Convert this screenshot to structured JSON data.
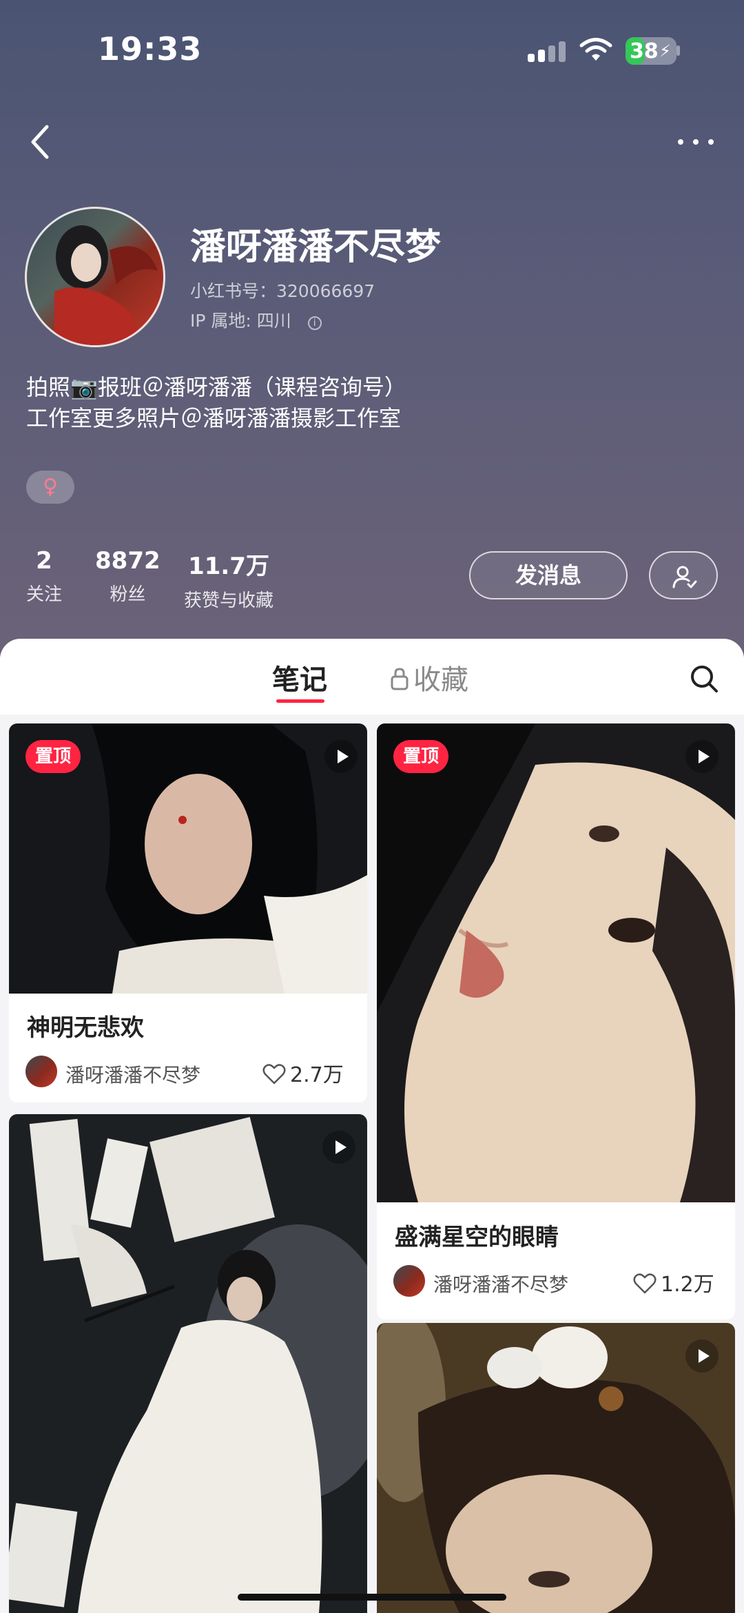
{
  "status_bar": {
    "time": "19:33",
    "battery": "38",
    "battery_level": 0.38
  },
  "profile": {
    "name": "潘呀潘潘不尽梦",
    "red_id": "小红书号：320066697",
    "ip_location": "IP 属地: 四川",
    "bio": [
      "拍照📷报班＠潘呀潘潘（课程咨询号）",
      "工作室更多照片＠潘呀潘潘摄影工作室"
    ],
    "gender_symbol": "♀"
  },
  "stats": [
    {
      "value": "2",
      "label": "关注"
    },
    {
      "value": "8872",
      "label": "粉丝"
    },
    {
      "value": "11.7万",
      "label": "获赞与收藏"
    }
  ],
  "actions": {
    "message_label": "发消息"
  },
  "tabs": {
    "notes": "笔记",
    "collections": "收藏"
  },
  "posts": [
    {
      "title": "神明无悲欢",
      "author": "潘呀潘潘不尽梦",
      "likes": "2.7万",
      "badge": "置顶",
      "is_video": true
    },
    {
      "title": "盛满星空的眼睛",
      "author": "潘呀潘潘不尽梦",
      "likes": "1.2万",
      "badge": "置顶",
      "is_video": true
    },
    {
      "title": "",
      "author": "",
      "likes": "",
      "badge": "",
      "is_video": true
    },
    {
      "title": "",
      "author": "",
      "likes": "",
      "badge": "",
      "is_video": true
    }
  ],
  "colors": {
    "accent": "#ff2442",
    "header_top": "#4a5472",
    "header_bottom": "#6b6278"
  }
}
